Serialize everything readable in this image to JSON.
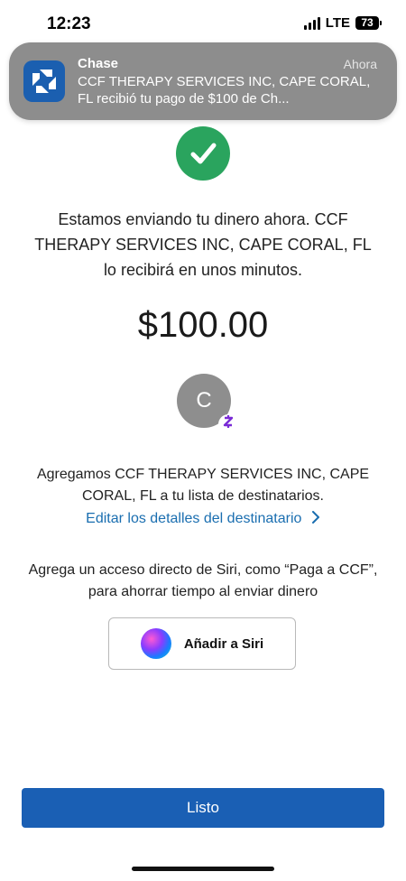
{
  "status_bar": {
    "time": "12:23",
    "network": "LTE",
    "battery": "73"
  },
  "notification": {
    "app": "Chase",
    "time": "Ahora",
    "text": "CCF THERAPY SERVICES INC, CAPE CORAL, FL recibió tu pago de $100 de Ch...",
    "icon": "chase-logo-icon"
  },
  "confirmation": {
    "icon": "checkmark-icon",
    "message": "Estamos enviando tu dinero ahora. CCF THERAPY SERVICES INC, CAPE CORAL, FL lo recibirá en unos minutos.",
    "amount": "$100.00"
  },
  "recipient": {
    "initial": "C",
    "badge": "Z",
    "added_text": "Agregamos CCF THERAPY SERVICES INC, CAPE CORAL, FL a tu lista de destinatarios.",
    "edit_link": "Editar los detalles del destinatario"
  },
  "siri": {
    "text": "Agrega un acceso directo de Siri, como “Paga a CCF”, para ahorrar tiempo al enviar dinero",
    "button_label": "Añadir a Siri"
  },
  "footer": {
    "done_label": "Listo"
  },
  "colors": {
    "success": "#2aa45e",
    "link": "#1a6eb0",
    "primary_button": "#1a5fb4",
    "zelle": "#7a2bd6"
  }
}
